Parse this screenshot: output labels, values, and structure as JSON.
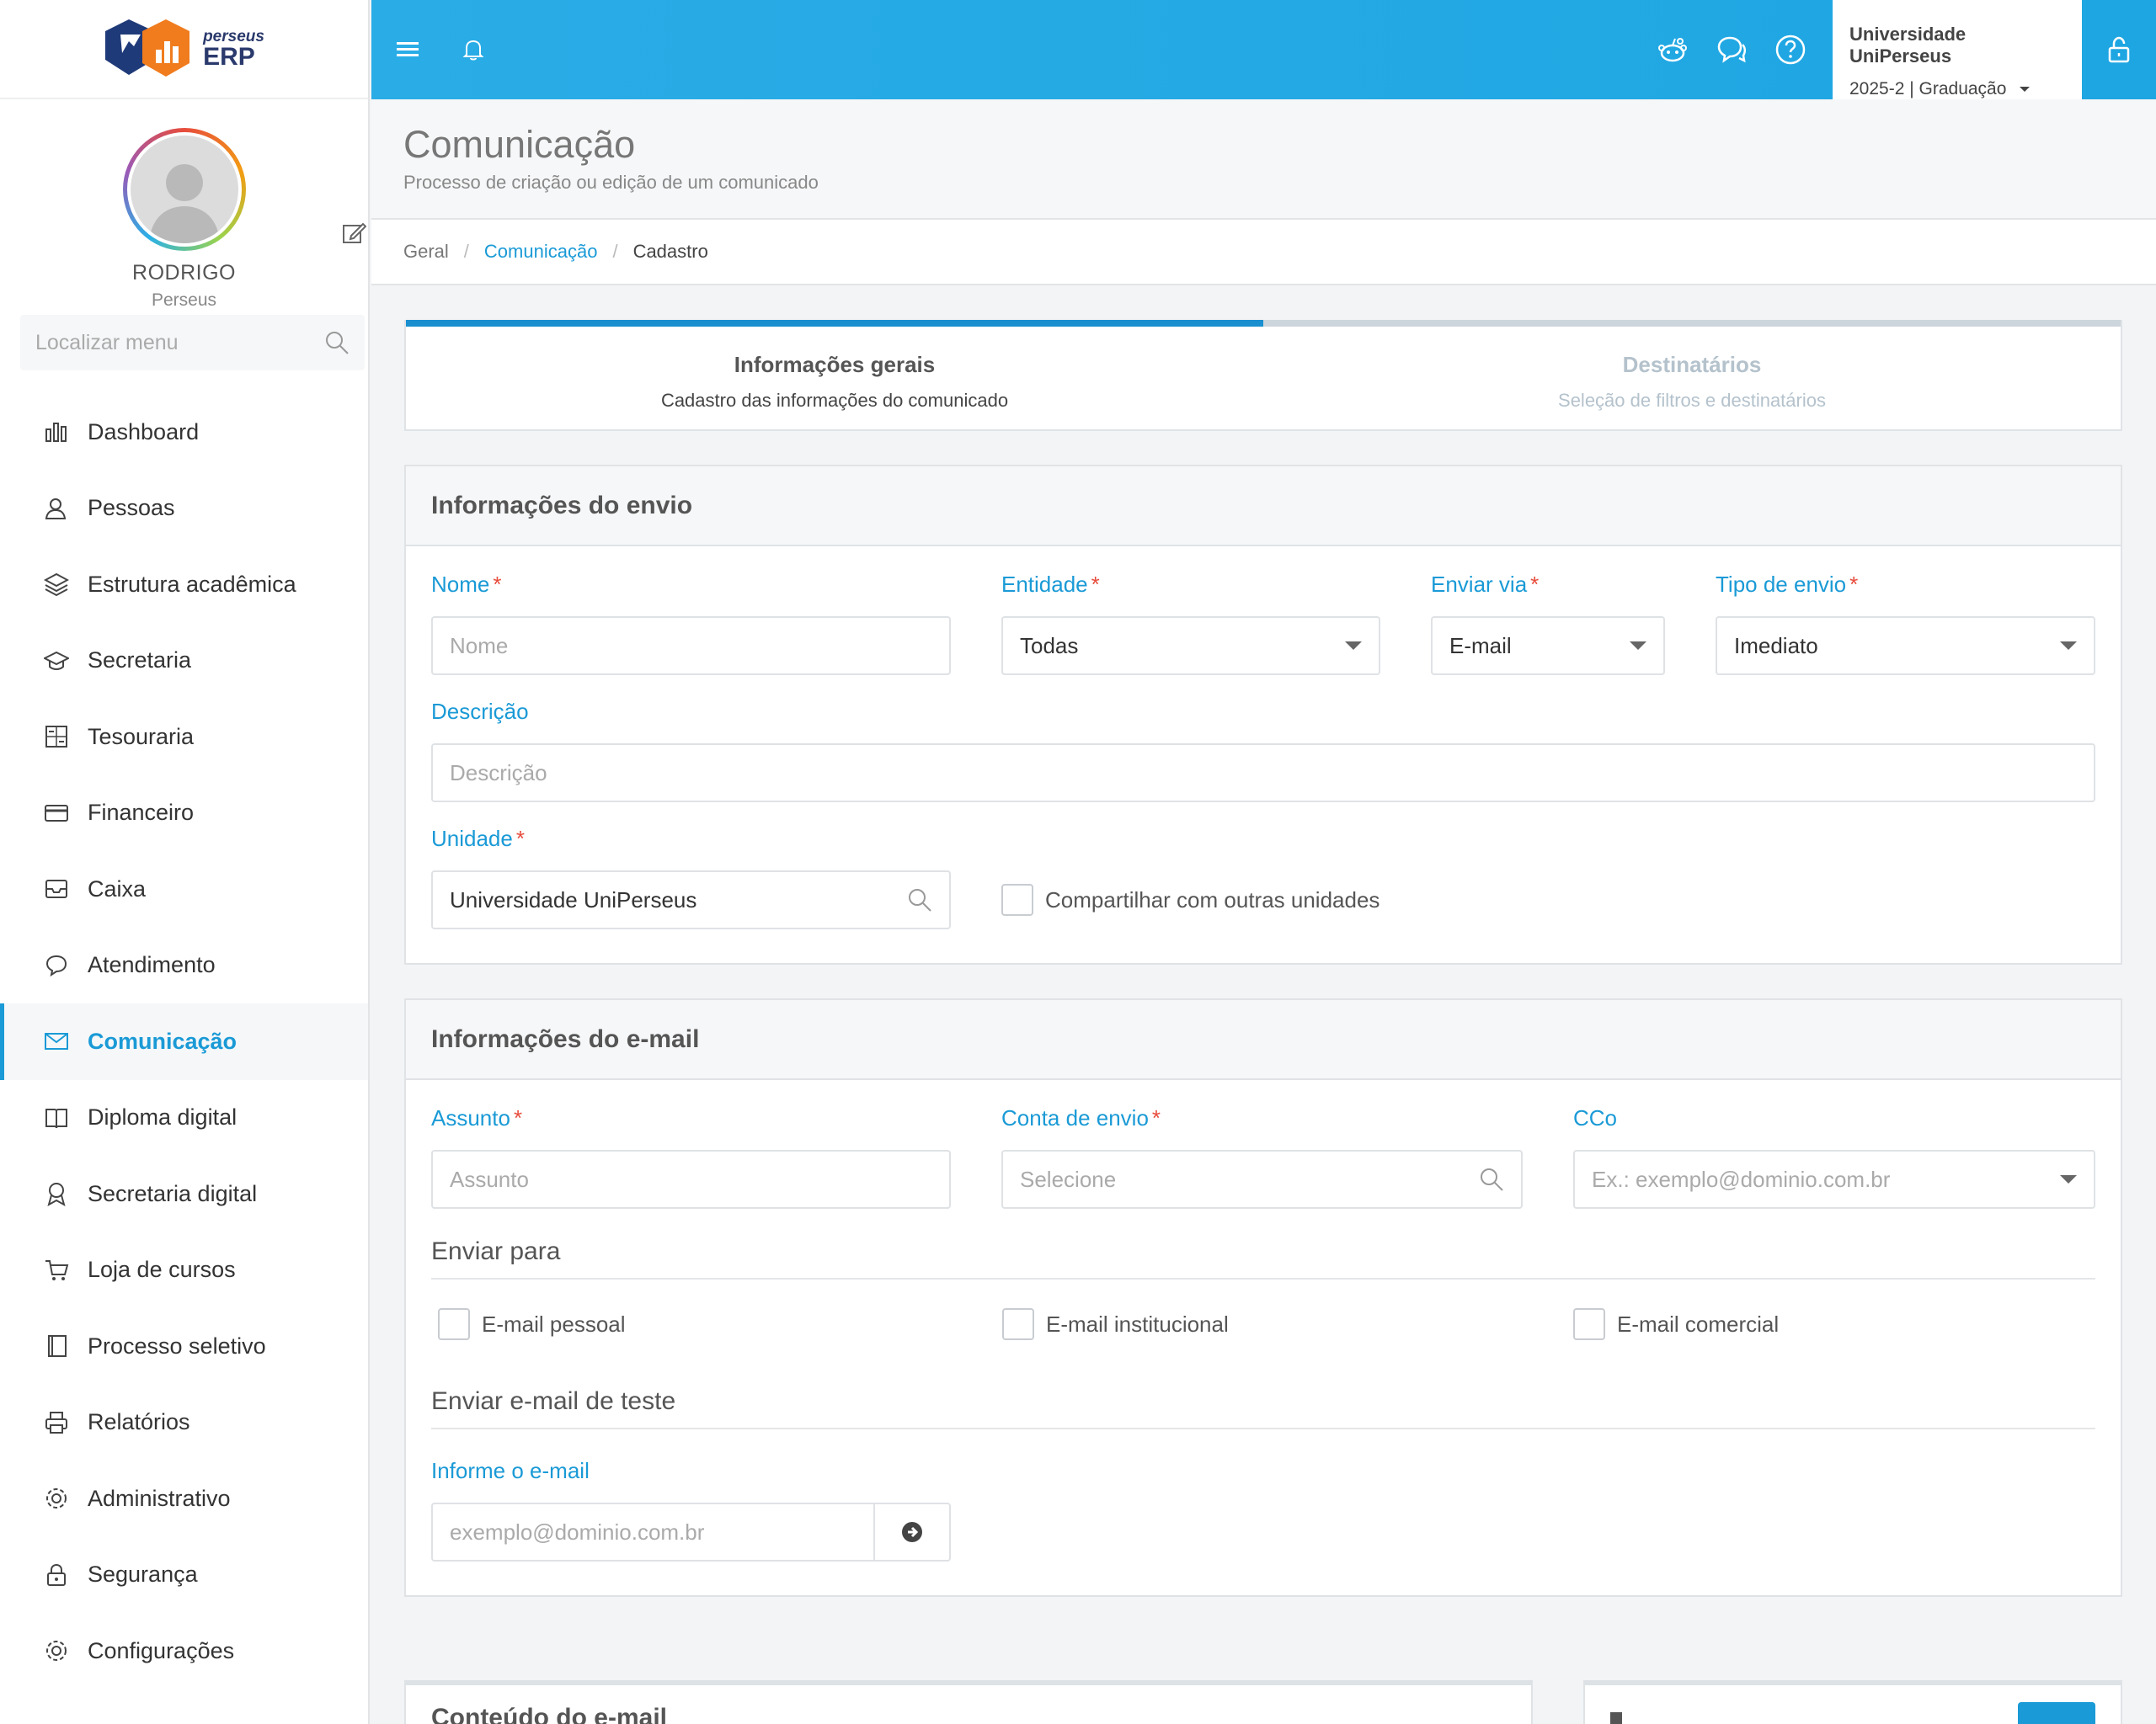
{
  "brand": {
    "logo_small": "perseus",
    "logo_big": "ERP",
    "colors": {
      "primary": "#1a9ad6",
      "topbar": "#2aace6",
      "logo_dark": "#1f3a78",
      "logo_orange": "#f07c1e"
    }
  },
  "profile": {
    "name": "RODRIGO",
    "org": "Perseus"
  },
  "menu_search": {
    "placeholder": "Localizar menu"
  },
  "menu": [
    {
      "label": "Dashboard",
      "icon": "bar-chart-icon"
    },
    {
      "label": "Pessoas",
      "icon": "user-icon"
    },
    {
      "label": "Estrutura acadêmica",
      "icon": "layers-icon"
    },
    {
      "label": "Secretaria",
      "icon": "graduation-cap-icon"
    },
    {
      "label": "Tesouraria",
      "icon": "calculator-icon"
    },
    {
      "label": "Financeiro",
      "icon": "credit-card-icon"
    },
    {
      "label": "Caixa",
      "icon": "inbox-icon"
    },
    {
      "label": "Atendimento",
      "icon": "chat-icon"
    },
    {
      "label": "Comunicação",
      "icon": "envelope-icon",
      "active": true
    },
    {
      "label": "Diploma digital",
      "icon": "book-icon"
    },
    {
      "label": "Secretaria digital",
      "icon": "award-icon"
    },
    {
      "label": "Loja de cursos",
      "icon": "cart-icon"
    },
    {
      "label": "Processo seletivo",
      "icon": "notebook-icon"
    },
    {
      "label": "Relatórios",
      "icon": "printer-icon"
    },
    {
      "label": "Administrativo",
      "icon": "gear-icon"
    },
    {
      "label": "Segurança",
      "icon": "lock-icon"
    },
    {
      "label": "Configurações",
      "icon": "settings-icon"
    }
  ],
  "topbar": {
    "university": "Universidade UniPerseus",
    "period": "2025-2 | Graduação"
  },
  "page": {
    "title": "Comunicação",
    "subtitle": "Processo de criação ou edição de um comunicado"
  },
  "breadcrumb": {
    "root": "Geral",
    "section": "Comunicação",
    "current": "Cadastro"
  },
  "steps": [
    {
      "title": "Informações gerais",
      "subtitle": "Cadastro das informações do comunicado"
    },
    {
      "title": "Destinatários",
      "subtitle": "Seleção de filtros e destinatários"
    }
  ],
  "envio": {
    "heading": "Informações do envio",
    "nome": {
      "label": "Nome",
      "placeholder": "Nome"
    },
    "entidade": {
      "label": "Entidade",
      "value": "Todas"
    },
    "enviar_via": {
      "label": "Enviar via",
      "value": "E-mail"
    },
    "tipo_envio": {
      "label": "Tipo de envio",
      "value": "Imediato"
    },
    "descricao": {
      "label": "Descrição",
      "placeholder": "Descrição"
    },
    "unidade": {
      "label": "Unidade",
      "value": "Universidade UniPerseus"
    },
    "compartilhar": "Compartilhar com outras unidades"
  },
  "email": {
    "heading": "Informações do e-mail",
    "assunto": {
      "label": "Assunto",
      "placeholder": "Assunto"
    },
    "conta": {
      "label": "Conta de envio",
      "placeholder": "Selecione"
    },
    "cco": {
      "label": "CCo",
      "placeholder": "Ex.: exemplo@dominio.com.br"
    },
    "enviar_para": "Enviar para",
    "opcoes": [
      "E-mail pessoal",
      "E-mail institucional",
      "E-mail comercial"
    ],
    "teste_title": "Enviar e-mail de teste",
    "teste_label": "Informe o e-mail",
    "teste_placeholder": "exemplo@dominio.com.br"
  },
  "bottom": {
    "conteudo_heading": "Conteúdo do e-mail"
  }
}
